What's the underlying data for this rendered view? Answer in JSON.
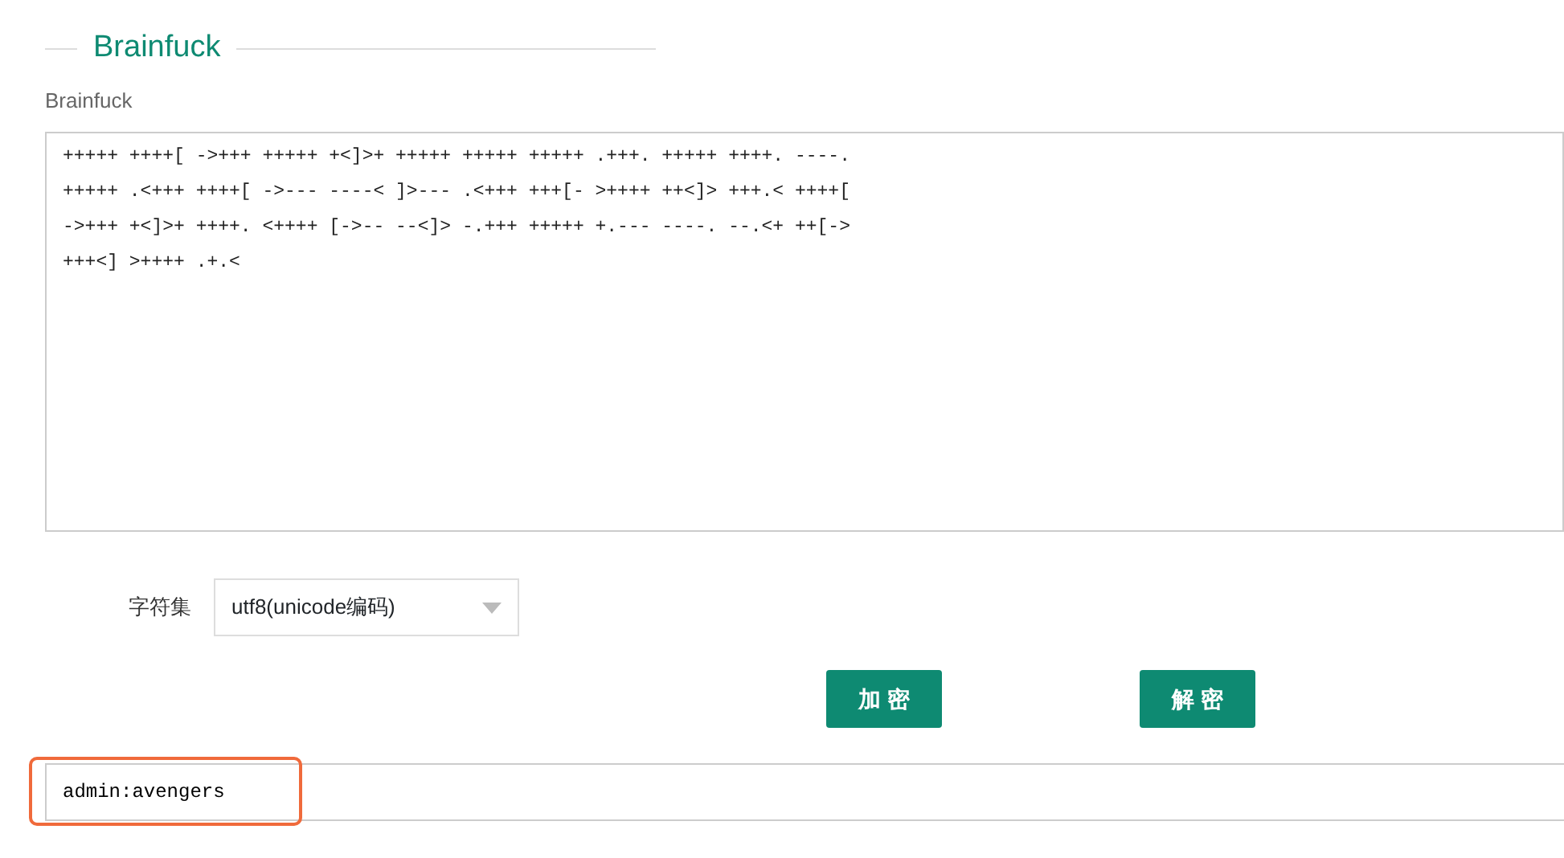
{
  "section_title": "Brainfuck",
  "input_label": "Brainfuck",
  "code_input": "+++++ ++++[ ->+++ +++++ +<]>+ +++++ +++++ +++++ .+++. +++++ ++++. ----.\n+++++ .<+++ ++++[ ->--- ----< ]>--- .<+++ +++[- >++++ ++<]> +++.< ++++[\n->+++ +<]>+ ++++. <++++ [->-- --<]> -.+++ +++++ +.--- ----. --.<+ ++[->\n+++<] >++++ .+.<",
  "charset": {
    "label": "字符集",
    "value": "utf8(unicode编码)"
  },
  "buttons": [
    {
      "label": "加 密"
    },
    {
      "label": "解 密"
    }
  ],
  "output": {
    "value": "admin:avengers",
    "highlighted": true
  }
}
